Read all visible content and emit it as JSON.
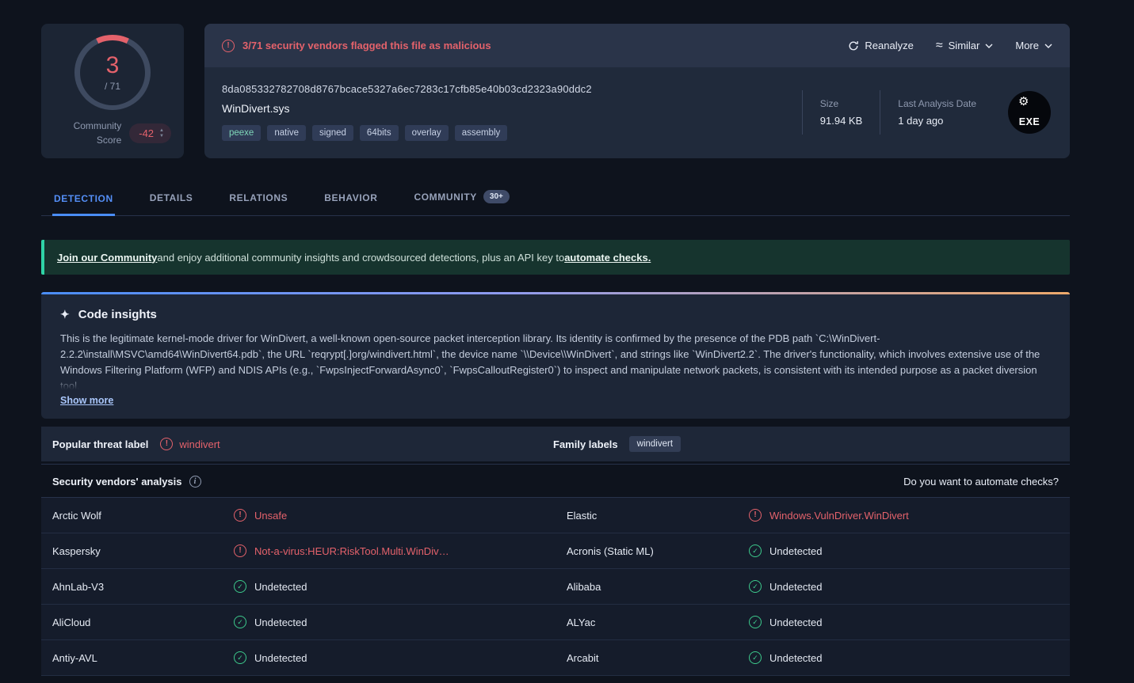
{
  "score": {
    "detections": "3",
    "total": "/ 71",
    "community_label_line1": "Community",
    "community_label_line2": "Score",
    "community_score": "-42"
  },
  "file": {
    "alert": "3/71 security vendors flagged this file as malicious",
    "hash": "8da085332782708d8767bcace5327a6ec7283c17cfb85e40b03cd2323a90ddc2",
    "name": "WinDivert.sys",
    "tags": [
      {
        "label": "peexe",
        "accent": true
      },
      {
        "label": "native",
        "accent": false
      },
      {
        "label": "signed",
        "accent": false
      },
      {
        "label": "64bits",
        "accent": false
      },
      {
        "label": "overlay",
        "accent": false
      },
      {
        "label": "assembly",
        "accent": false
      }
    ],
    "size_label": "Size",
    "size_value": "91.94 KB",
    "last_analysis_label": "Last Analysis Date",
    "last_analysis_value": "1 day ago",
    "type_badge": "EXE"
  },
  "actions": {
    "reanalyze": "Reanalyze",
    "similar": "Similar",
    "more": "More"
  },
  "tabs": [
    {
      "label": "DETECTION"
    },
    {
      "label": "DETAILS"
    },
    {
      "label": "RELATIONS"
    },
    {
      "label": "BEHAVIOR"
    },
    {
      "label": "COMMUNITY",
      "badge": "30+"
    }
  ],
  "community_banner": {
    "link1": "Join our Community",
    "text1": " and enjoy additional community insights and crowdsourced detections, plus an API key to ",
    "link2": "automate checks."
  },
  "code_insights": {
    "title": "Code insights",
    "body": "This is the legitimate kernel-mode driver for WinDivert, a well-known open-source packet interception library. Its identity is confirmed by the presence of the PDB path `C:\\WinDivert-2.2.2\\install\\MSVC\\amd64\\WinDivert64.pdb`, the URL `reqrypt[.]org/windivert.html`, the device name `\\\\Device\\\\WinDivert`, and strings like `WinDivert2.2`. The driver's functionality, which involves extensive use of the Windows Filtering Platform (WFP) and NDIS APIs (e.g., `FwpsInjectForwardAsync0`, `FwpsCalloutRegister0`) to inspect and manipulate network packets, is consistent with its intended purpose as a packet diversion tool.",
    "show_more": "Show more"
  },
  "threat": {
    "label": "Popular threat label",
    "value": "windivert",
    "family_label": "Family labels",
    "family_value": "windivert"
  },
  "analysis": {
    "title": "Security vendors' analysis",
    "automate": "Do you want to automate checks?",
    "rows": [
      {
        "left": {
          "vendor": "Arctic Wolf",
          "status": "Unsafe",
          "type": "alert"
        },
        "right": {
          "vendor": "Elastic",
          "status": "Windows.VulnDriver.WinDivert",
          "type": "alert"
        }
      },
      {
        "left": {
          "vendor": "Kaspersky",
          "status": "Not-a-virus:HEUR:RiskTool.Multi.WinDiv…",
          "type": "alert"
        },
        "right": {
          "vendor": "Acronis (Static ML)",
          "status": "Undetected",
          "type": "clean"
        }
      },
      {
        "left": {
          "vendor": "AhnLab-V3",
          "status": "Undetected",
          "type": "clean"
        },
        "right": {
          "vendor": "Alibaba",
          "status": "Undetected",
          "type": "clean"
        }
      },
      {
        "left": {
          "vendor": "AliCloud",
          "status": "Undetected",
          "type": "clean"
        },
        "right": {
          "vendor": "ALYac",
          "status": "Undetected",
          "type": "clean"
        }
      },
      {
        "left": {
          "vendor": "Antiy-AVL",
          "status": "Undetected",
          "type": "clean"
        },
        "right": {
          "vendor": "Arcabit",
          "status": "Undetected",
          "type": "clean"
        }
      }
    ]
  }
}
